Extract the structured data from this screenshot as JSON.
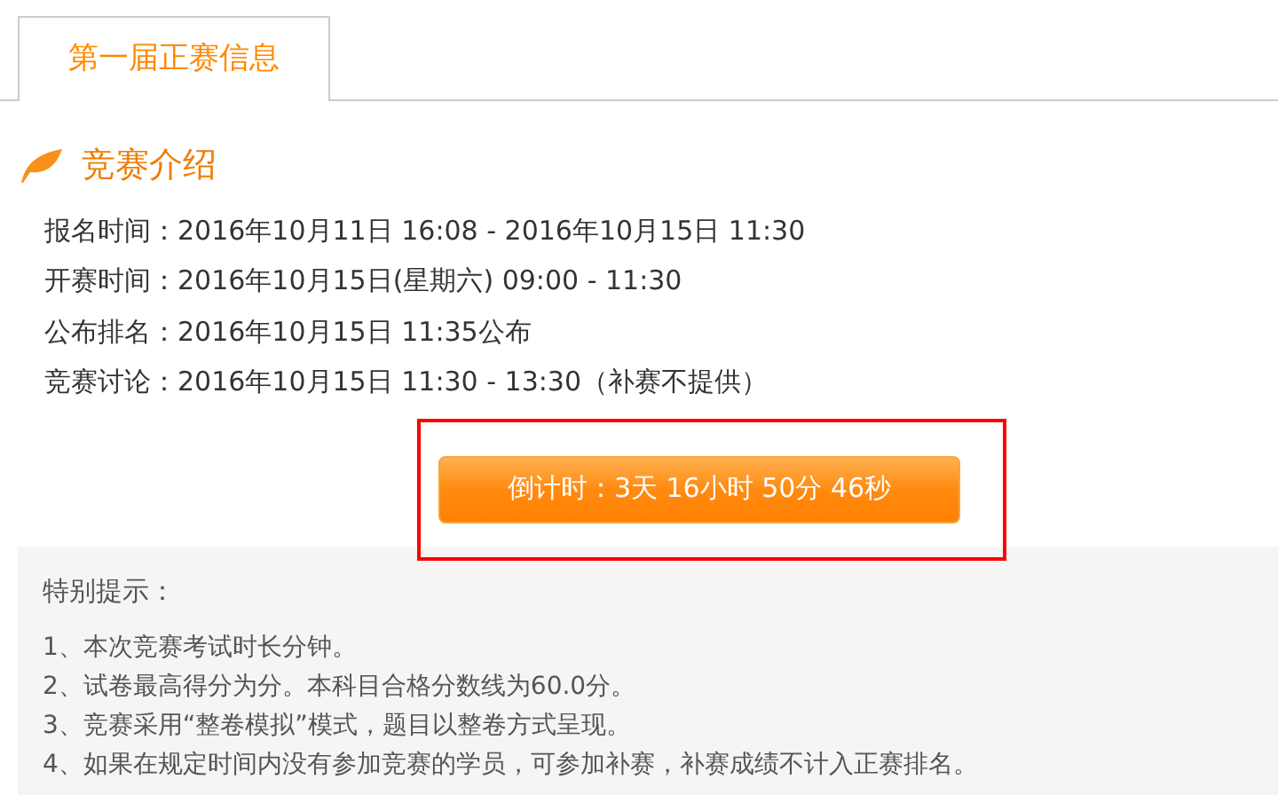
{
  "tabs": [
    {
      "label": "第一届正赛信息",
      "selected": true
    }
  ],
  "section": {
    "title": "竞赛介绍"
  },
  "info": [
    {
      "label": "报名时间：",
      "value": "2016年10月11日 16:08 - 2016年10月15日 11:30"
    },
    {
      "label": "开赛时间：",
      "value": "2016年10月15日(星期六) 09:00 - 11:30"
    },
    {
      "label": "公布排名：",
      "value": "2016年10月15日 11:35公布"
    },
    {
      "label": "竞赛讨论：",
      "value": "2016年10月15日 11:30 - 13:30（补赛不提供）"
    }
  ],
  "countdown": {
    "label": "倒计时：3天 16小时 50分 46秒",
    "highlighted": true
  },
  "notes": {
    "title": "特别提示：",
    "items": [
      "1、本次竞赛考试时长分钟。",
      "2、试卷最高得分为分。本科目合格分数线为60.0分。",
      "3、竞赛采用“整卷模拟”模式，题目以整卷方式呈现。",
      "4、如果在规定时间内没有参加竞赛的学员，可参加补赛，补赛成绩不计入正赛排名。"
    ]
  }
}
